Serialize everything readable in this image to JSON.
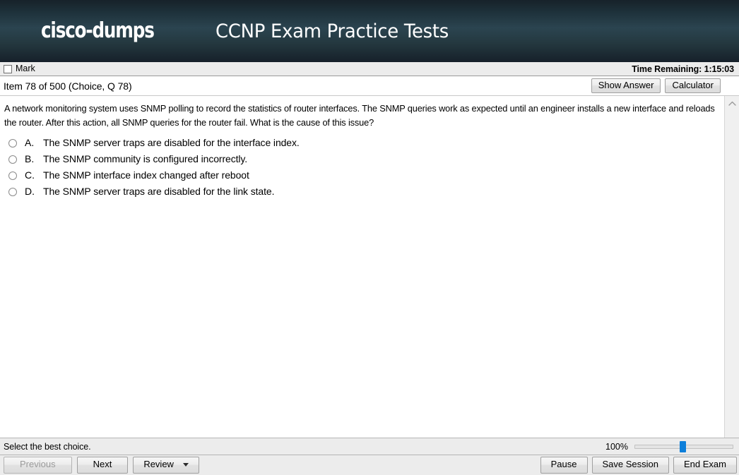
{
  "banner": {
    "logo": "cisco-dumps",
    "title": "CCNP Exam Practice Tests"
  },
  "markbar": {
    "mark_label": "Mark",
    "timer": "Time Remaining: 1:15:03"
  },
  "item_header": {
    "item_label": "Item 78 of 500 (Choice, Q 78)",
    "show_answer_label": "Show Answer",
    "calculator_label": "Calculator"
  },
  "question": {
    "text": "A network monitoring system uses SNMP polling to record the statistics of router interfaces. The SNMP queries work as expected until an engineer installs a new interface and reloads the router. After this action, all SNMP queries for the router fail. What is the cause of this issue?",
    "options": [
      {
        "letter": "A.",
        "text": "The SNMP server traps are disabled for the interface index.",
        "selected": false
      },
      {
        "letter": "B.",
        "text": "The SNMP community is configured incorrectly.",
        "selected": false
      },
      {
        "letter": "C.",
        "text": "The SNMP interface index changed after reboot",
        "selected": false
      },
      {
        "letter": "D.",
        "text": "The SNMP server traps are disabled for the link state.",
        "selected": false
      }
    ]
  },
  "statusbar": {
    "status_text": "Select the best choice.",
    "zoom_percent": "100%"
  },
  "navbar": {
    "previous_label": "Previous",
    "next_label": "Next",
    "review_label": "Review",
    "pause_label": "Pause",
    "save_session_label": "Save Session",
    "end_exam_label": "End Exam"
  },
  "colors": {
    "banner_top": "#17222a",
    "banner_mid": "#2b4450",
    "banner_bottom": "#16202a",
    "chrome": "#ececec",
    "slider_thumb": "#0d7fda"
  }
}
